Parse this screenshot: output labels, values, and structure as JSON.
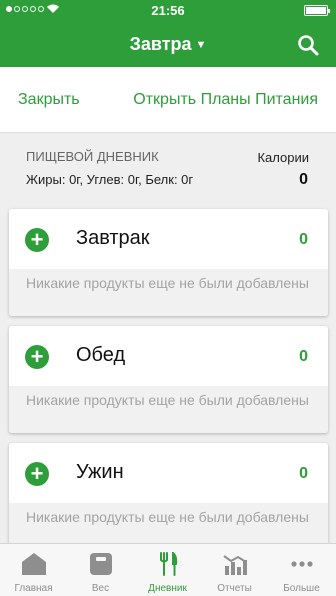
{
  "status": {
    "time": "21:56"
  },
  "header": {
    "title": "Завтра"
  },
  "actions": {
    "close": "Закрыть",
    "open_plans": "Открыть Планы Питания"
  },
  "summary": {
    "title": "Пищевой дневник",
    "macros": "Жиры: 0г, Углев: 0г, Белк: 0г",
    "calories_label": "Калории",
    "calories_value": "0"
  },
  "meals": [
    {
      "name": "Завтрак",
      "calories": "0",
      "empty_text": "Никакие продукты еще не были добавлены"
    },
    {
      "name": "Обед",
      "calories": "0",
      "empty_text": "Никакие продукты еще не были добавлены"
    },
    {
      "name": "Ужин",
      "calories": "0",
      "empty_text": "Никакие продукты еще не были добавлены"
    }
  ],
  "tabs": [
    {
      "label": "Главная",
      "icon": "home-icon"
    },
    {
      "label": "Вес",
      "icon": "scale-icon"
    },
    {
      "label": "Дневник",
      "icon": "fork-knife-icon"
    },
    {
      "label": "Отчеты",
      "icon": "chart-icon"
    },
    {
      "label": "Больше",
      "icon": "more-icon"
    }
  ],
  "colors": {
    "accent": "#2e9e3a",
    "background": "#efefef",
    "tab_inactive": "#8e8e8e"
  }
}
